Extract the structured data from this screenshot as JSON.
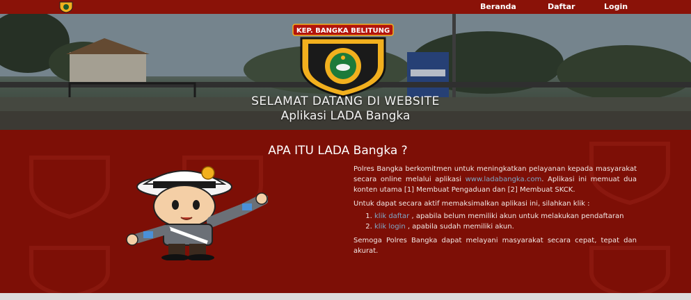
{
  "navbar": {
    "logo_icon": "polri-badge-icon",
    "links": [
      {
        "label": "Beranda"
      },
      {
        "label": "Daftar"
      },
      {
        "label": "Login"
      }
    ],
    "background_color": "#8a1208"
  },
  "hero": {
    "badge_banner": "KEP. BANGKA BELITUNG",
    "title": "SELAMAT DATANG DI WEBSITE",
    "subtitle": "Aplikasi LADA Bangka"
  },
  "about": {
    "title": "APA ITU LADA Bangka ?",
    "paragraph1_before_link": "Polres Bangka berkomitmen untuk meningkatkan pelayanan kepada masyarakat secara online melalui aplikasi ",
    "site_link": "www.ladabangka.com",
    "paragraph1_after_link": ". Aplikasi ini memuat dua konten utama [1] Membuat Pengaduan dan [2] Membuat SKCK.",
    "paragraph2": "Untuk dapat secara aktif memaksimalkan aplikasi ini, silahkan klik :",
    "steps": [
      {
        "link": "klik daftar",
        "text": " , apabila belum memiliki akun untuk melakukan pendaftaran"
      },
      {
        "link": "klik login",
        "text": " , apabila sudah memiliki akun."
      }
    ],
    "closing": "Semoga Polres Bangka dapat melayani masyarakat secara cepat, tepat dan akurat.",
    "background_color": "#7d0f06",
    "link_color": "#7fa8c8"
  }
}
